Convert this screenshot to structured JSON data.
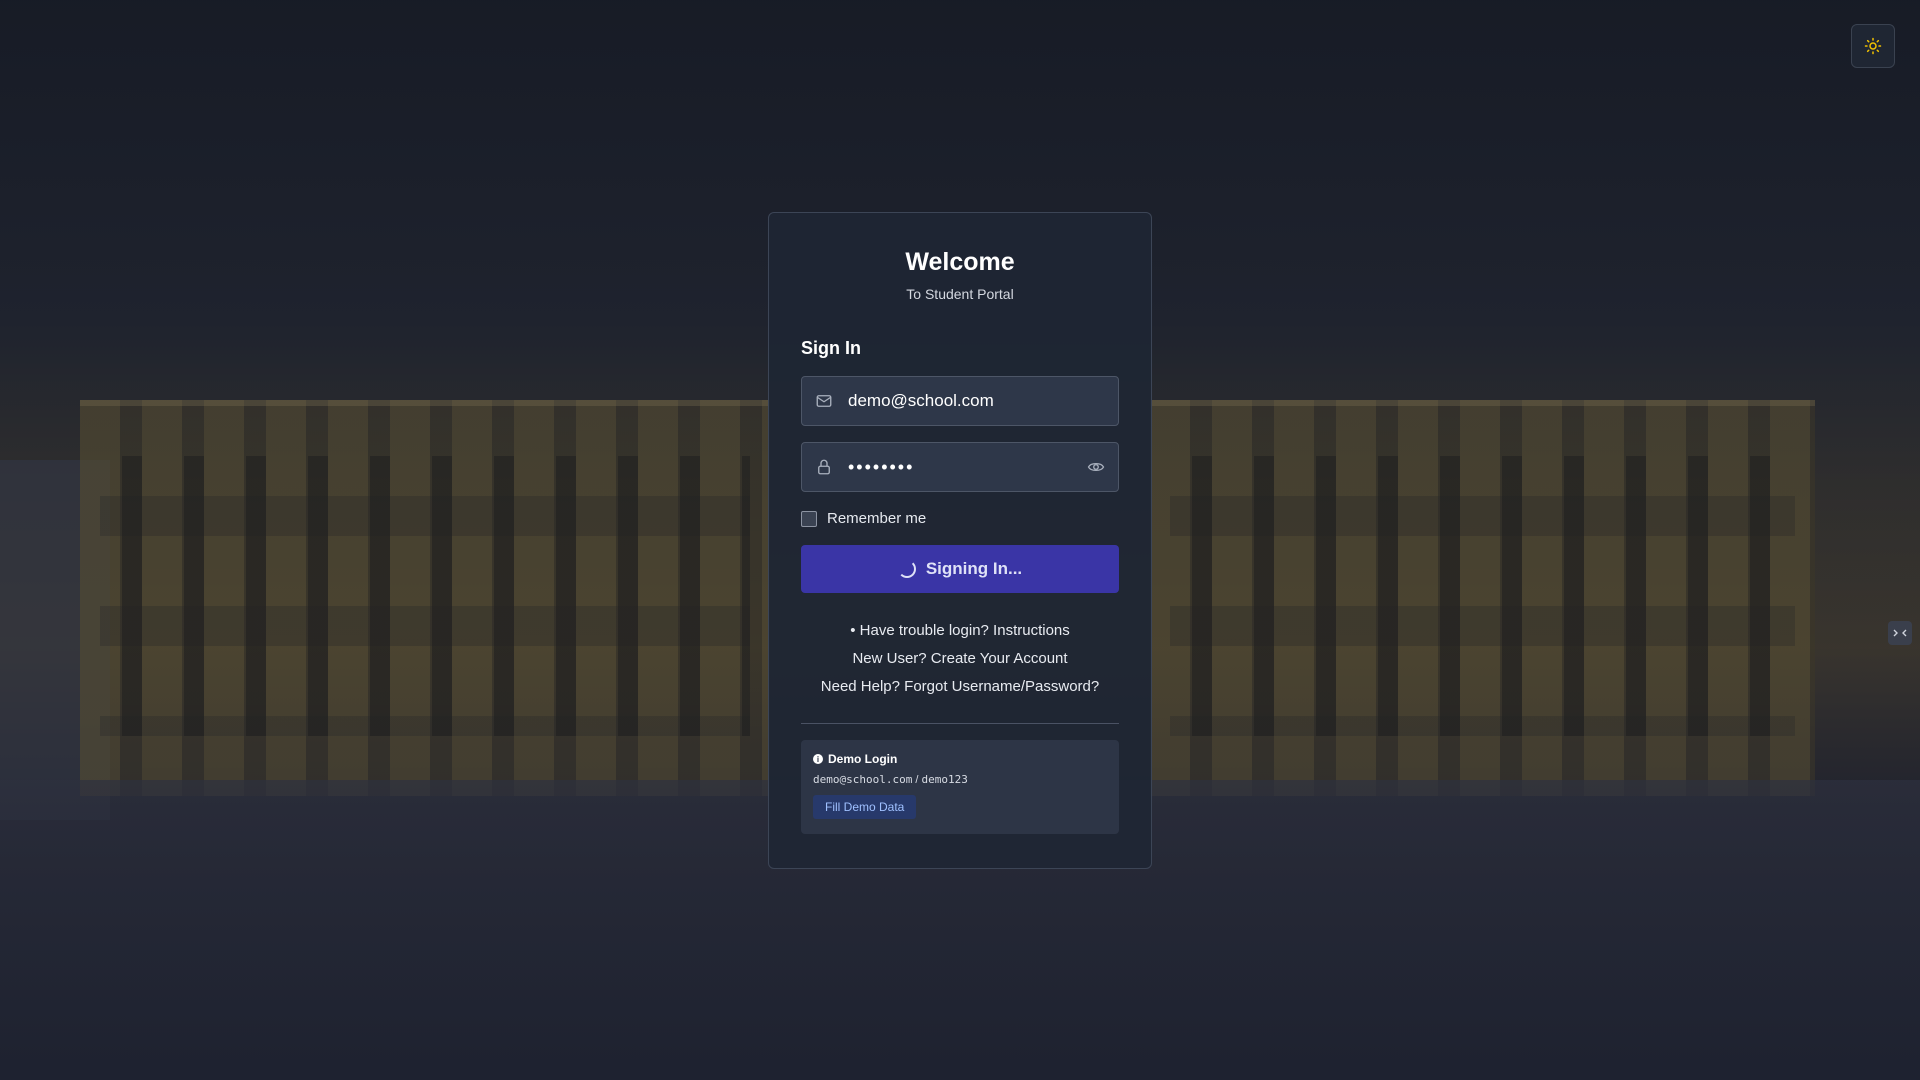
{
  "header": {
    "title": "Welcome",
    "subtitle": "To Student Portal"
  },
  "form": {
    "heading": "Sign In",
    "email_value": "demo@school.com",
    "password_value": "••••••••",
    "remember_label": "Remember me",
    "submit_label": "Signing In..."
  },
  "links": {
    "trouble": "• Have trouble login? Instructions",
    "new_user": "New User? Create Your Account",
    "need_help": "Need Help? Forgot Username/Password?"
  },
  "demo": {
    "title": "Demo Login",
    "email": "demo@school.com",
    "separator": " / ",
    "password": "demo123",
    "fill_label": "Fill Demo Data"
  },
  "icons": {
    "theme": "sun-icon",
    "email": "mail-icon",
    "password": "lock-icon",
    "toggle": "eye-icon",
    "info": "info-icon",
    "spinner": "spinner-icon"
  },
  "colors": {
    "accent": "#3a35a6",
    "card_bg": "#1e2634",
    "demo_button": "#27396b",
    "sun": "#f2c200"
  }
}
